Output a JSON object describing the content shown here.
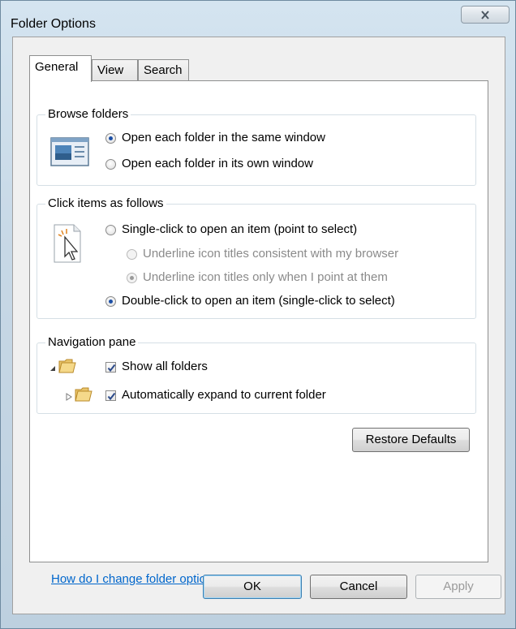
{
  "window": {
    "title": "Folder Options",
    "close_glyph": "X"
  },
  "tabs": [
    {
      "label": "General",
      "active": true
    },
    {
      "label": "View",
      "active": false
    },
    {
      "label": "Search",
      "active": false
    }
  ],
  "browse_folders": {
    "label": "Browse folders",
    "icon": "window-icon",
    "options": [
      {
        "label": "Open each folder in the same window",
        "checked": true
      },
      {
        "label": "Open each folder in its own window",
        "checked": false
      }
    ]
  },
  "click_items": {
    "label": "Click items as follows",
    "icon": "pointer-click-icon",
    "single_click": {
      "label": "Single-click to open an item (point to select)",
      "checked": false
    },
    "underline_browser": {
      "label": "Underline icon titles consistent with my browser",
      "checked": false,
      "enabled": false
    },
    "underline_point": {
      "label": "Underline icon titles only when I point at them",
      "checked": true,
      "enabled": false
    },
    "double_click": {
      "label": "Double-click to open an item (single-click to select)",
      "checked": true
    }
  },
  "navigation_pane": {
    "label": "Navigation pane",
    "show_all_folders": {
      "label": "Show all folders",
      "checked": true
    },
    "auto_expand": {
      "label": "Automatically expand to current folder",
      "checked": true
    }
  },
  "buttons": {
    "restore_defaults": "Restore Defaults",
    "ok": "OK",
    "cancel": "Cancel",
    "apply": "Apply"
  },
  "help_link": "How do I change folder options?",
  "colors": {
    "link": "#0066cc",
    "radio_dot": "#1c4fa5",
    "check": "#2b4a8a"
  }
}
